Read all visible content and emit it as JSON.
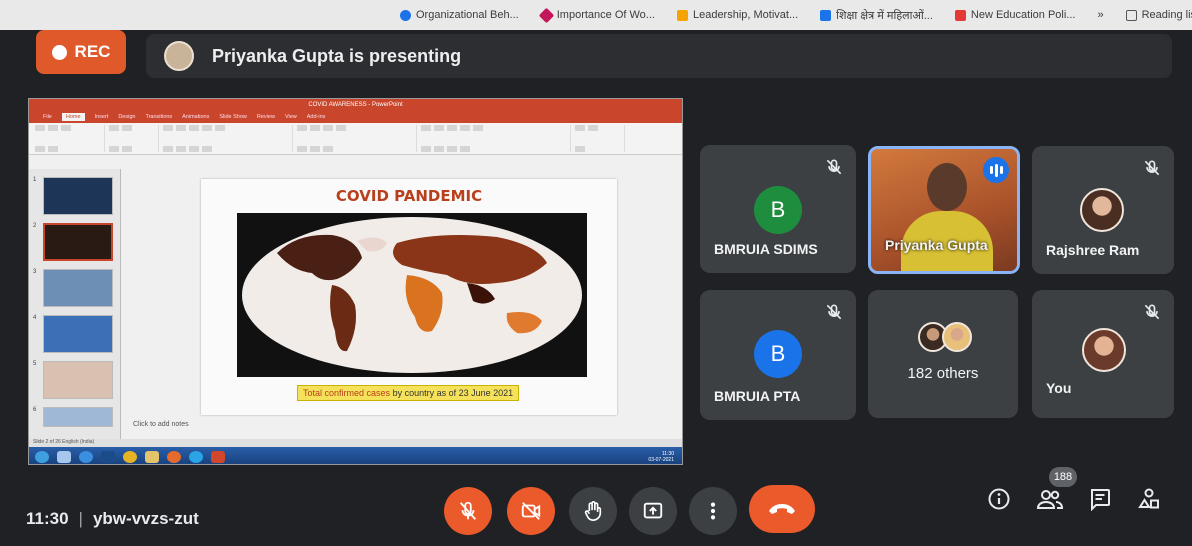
{
  "bookmarks": [
    {
      "label": "Organizational Beh...",
      "icon": "globe-icon",
      "color": "#1a73e8"
    },
    {
      "label": "Importance Of Wo...",
      "icon": "heart-icon",
      "color": "#c2185b"
    },
    {
      "label": "Leadership, Motivat...",
      "icon": "bookmark-icon",
      "color": "#f4a300"
    },
    {
      "label": "शिक्षा क्षेत्र में महिलाओं...",
      "icon": "doc-icon",
      "color": "#1a73e8"
    },
    {
      "label": "New Education Poli...",
      "icon": "youtube-icon",
      "color": "#e53935"
    },
    {
      "label": "»",
      "icon": "",
      "color": ""
    },
    {
      "label": "Reading list",
      "icon": "reading-list-icon",
      "color": "#555"
    }
  ],
  "rec": {
    "label": "REC",
    "color": "#e0592a"
  },
  "presenting": {
    "text": "Priyanka Gupta is presenting"
  },
  "shared_screen": {
    "ppt_title": "COVID AWARENESS - PowerPoint",
    "ppt_tabs": [
      "File",
      "Home",
      "Insert",
      "Design",
      "Transitions",
      "Animations",
      "Slide Show",
      "Review",
      "View",
      "Add-ins"
    ],
    "slide_title": "COVID PANDEMIC",
    "caption_highlight": "Total confirmed cases",
    "caption_rest": "by country as of 23 June 2021",
    "notes_placeholder": "Click to add notes",
    "slide_numbers": [
      "1",
      "2",
      "3",
      "4",
      "5",
      "6"
    ],
    "status": "Slide 2 of 26   English (India)",
    "clock_time": "11:30",
    "clock_date": "03-07-2021"
  },
  "participants": [
    {
      "name": "BMRUIA SDIMS",
      "initial": "B",
      "color": "#1e8e3e",
      "muted": true
    },
    {
      "name": "Priyanka Gupta",
      "initial": "",
      "color": "",
      "muted": false,
      "speaking": true
    },
    {
      "name": "Rajshree Ram",
      "initial": "",
      "color": "",
      "muted": true
    },
    {
      "name": "BMRUIA PTA",
      "initial": "B",
      "color": "#1a73e8",
      "muted": true
    },
    {
      "name": "182 others",
      "initial": "",
      "color": "",
      "muted": false
    },
    {
      "name": "You",
      "initial": "",
      "color": "",
      "muted": true
    }
  ],
  "bottom": {
    "time": "11:30",
    "meeting_code": "ybw-vvzs-zut",
    "participant_count": "188"
  },
  "controls": {
    "accent": "#ea5a2b",
    "items": [
      "mic-off-icon",
      "camera-off-icon",
      "raise-hand-icon",
      "present-icon",
      "more-icon",
      "end-call-icon",
      "info-icon",
      "people-icon",
      "chat-icon",
      "activities-icon"
    ]
  }
}
